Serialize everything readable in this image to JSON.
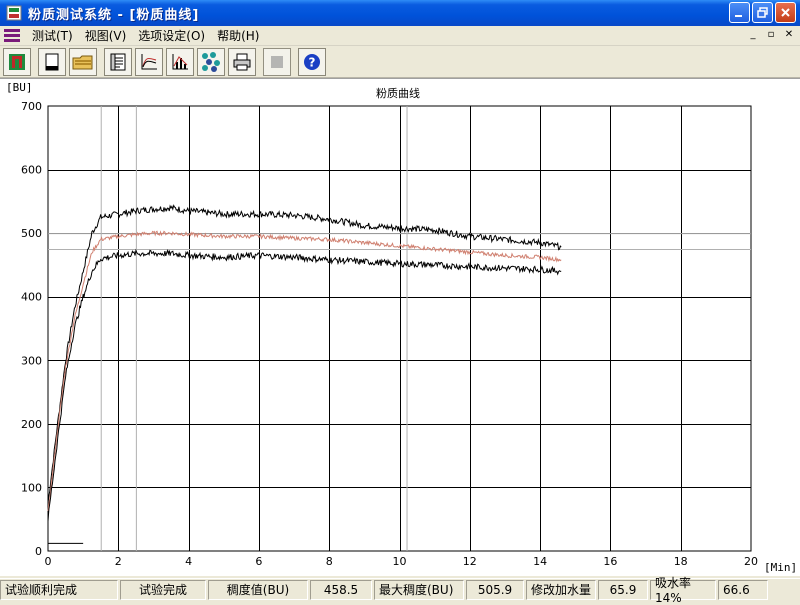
{
  "window": {
    "title": "粉质测试系统 - [粉质曲线]"
  },
  "menu": {
    "items": [
      "测试(T)",
      "视图(V)",
      "选项设定(O)",
      "帮助(H)"
    ]
  },
  "toolbar": {
    "icons": [
      "exit-icon",
      "new-document-icon",
      "open-folder-icon",
      "report-icon",
      "curve-icon",
      "analysis-chart-icon",
      "molecule-icon",
      "print-icon",
      "stop-icon",
      "help-icon"
    ]
  },
  "chart_data": {
    "type": "line",
    "title": "粉质曲线",
    "ylabel": "[BU]",
    "xlabel": "[Min]",
    "xlim": [
      0,
      20
    ],
    "ylim": [
      0,
      700
    ],
    "x_ticks": [
      0,
      2,
      4,
      6,
      8,
      10,
      12,
      14,
      16,
      18,
      20
    ],
    "y_ticks": [
      0,
      100,
      200,
      300,
      400,
      500,
      600,
      700
    ],
    "grid": true,
    "series": [
      {
        "color": "#000000",
        "x": [
          0,
          0.25,
          0.5,
          0.75,
          1.0,
          1.25,
          1.5,
          2.0,
          2.5,
          3.0,
          3.5,
          4.0,
          5.0,
          6.0,
          7.0,
          8.0,
          9.0,
          10.0,
          11.0,
          12.0,
          13.0,
          14.0,
          14.6
        ],
        "values": [
          75,
          190,
          300,
          380,
          440,
          500,
          525,
          530,
          535,
          538,
          540,
          535,
          530,
          530,
          528,
          522,
          512,
          508,
          505,
          495,
          490,
          485,
          478
        ]
      },
      {
        "color": "#d08070",
        "x": [
          0,
          0.25,
          0.5,
          0.75,
          1.0,
          1.25,
          1.5,
          2.0,
          2.5,
          3.0,
          3.5,
          4.0,
          5.0,
          6.0,
          7.0,
          8.0,
          9.0,
          10.0,
          11.0,
          12.0,
          13.0,
          14.0,
          14.6
        ],
        "values": [
          60,
          180,
          290,
          365,
          420,
          470,
          490,
          495,
          498,
          500,
          500,
          498,
          495,
          495,
          492,
          490,
          485,
          480,
          475,
          470,
          465,
          462,
          458
        ]
      },
      {
        "color": "#000000",
        "x": [
          0,
          0.25,
          0.5,
          0.75,
          1.0,
          1.25,
          1.5,
          2.0,
          2.5,
          3.0,
          3.5,
          4.0,
          5.0,
          6.0,
          7.0,
          8.0,
          9.0,
          10.0,
          11.0,
          12.0,
          13.0,
          14.0,
          14.6
        ],
        "values": [
          50,
          165,
          275,
          350,
          400,
          440,
          460,
          465,
          468,
          468,
          468,
          465,
          462,
          465,
          462,
          458,
          455,
          452,
          450,
          447,
          445,
          443,
          440
        ]
      }
    ],
    "marker_lines": {
      "horizontal": [
        500,
        475
      ],
      "vertical": [
        1.5,
        2.5,
        10.2
      ]
    },
    "baseline_segment": {
      "x": [
        0,
        1.0
      ],
      "y": [
        12,
        12
      ]
    }
  },
  "status": {
    "left_msg": "试验顺利完成",
    "test_state": "试验完成",
    "consistency_label": "稠度值(BU)",
    "consistency_value": "458.5",
    "max_consistency_label": "最大稠度(BU)",
    "max_consistency_value": "505.9",
    "water_added_label": "修改加水量",
    "water_added_value": "65.9",
    "absorption_label": "吸水率14%",
    "absorption_value": "66.6"
  },
  "colors": {
    "title_bar": "#0052d9",
    "grid": "#000000",
    "curve_main": "#000000",
    "curve_mid": "#d08070",
    "marker": "#b0b0b0"
  }
}
